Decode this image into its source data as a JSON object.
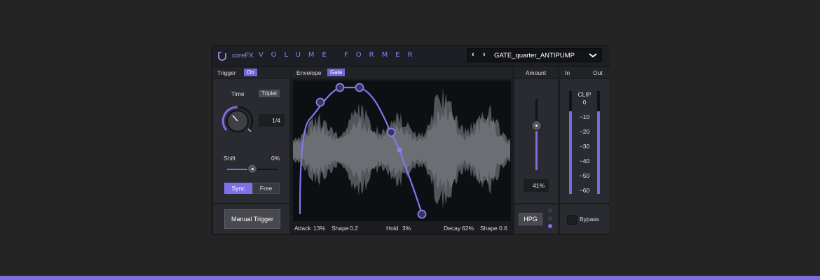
{
  "header": {
    "brand": "coreFX",
    "product": "VOLUME FORMER",
    "prev_icon": "‹",
    "next_icon": "›",
    "preset": "GATE_quarter_ANTIPUMP",
    "dropdown_icon": "chevron-down-icon"
  },
  "trigger": {
    "label": "Trigger",
    "state": "On",
    "time_label": "Time",
    "time_mode": "Triplet",
    "time_value": "1/4",
    "shift_label": "Shift",
    "shift_value": "0%",
    "shift_level": 0.5,
    "sync_label": "Sync",
    "free_label": "Free",
    "sync_selected": "Sync",
    "manual_label": "Manual Trigger"
  },
  "envelope": {
    "label": "Envelope",
    "mode": "Gate",
    "params": {
      "attack_label": "Attack",
      "attack_value": "13%",
      "shape_label": "Shape",
      "shape1_value": "0.2",
      "hold_label": "Hold",
      "hold_value": "3%",
      "decay_label": "Decay",
      "decay_value": "62%",
      "shape2_value": "0.6"
    }
  },
  "amount": {
    "label": "Amount",
    "value": "41%",
    "level": 0.41,
    "hpg_label": "HPG"
  },
  "meters": {
    "in_label": "In",
    "out_label": "Out",
    "clip_label": "CLIP",
    "scale": [
      "0",
      "−10",
      "−20",
      "−30",
      "−40",
      "−50",
      "−60"
    ],
    "in_level": 0.8,
    "out_level": 0.8,
    "bypass_label": "Bypass"
  },
  "colors": {
    "accent": "#7f6ce0",
    "panel": "#2a2b30",
    "background": "#242424"
  }
}
